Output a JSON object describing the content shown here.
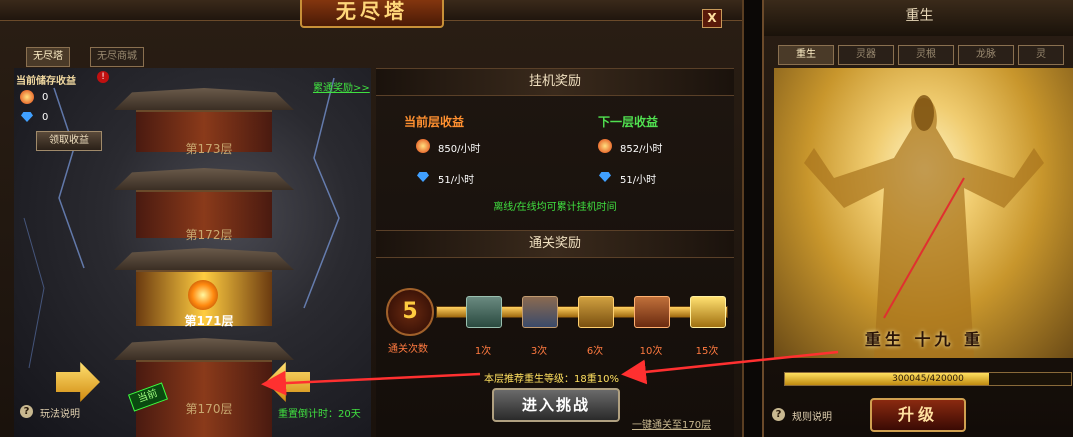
{
  "tower": {
    "title": "无尽塔",
    "close_label": "X",
    "tabs": [
      "无尽塔",
      "无尽商城"
    ],
    "stored_income_label": "当前储存收益",
    "fire_amount": "0",
    "gem_amount": "0",
    "claim_button": "领取收益",
    "cumulative_rewards_link": "累通奖励>>",
    "floors": [
      "第173层",
      "第172层",
      "第171层",
      "第170层"
    ],
    "current_badge": "当前",
    "help_link": "玩法说明",
    "reset_countdown": "重置倒计时：20天"
  },
  "idle_rewards": {
    "title": "挂机奖励",
    "current_label": "当前层收益",
    "next_label": "下一层收益",
    "current_fire": "850/小时",
    "current_gem": "51/小时",
    "next_fire": "852/小时",
    "next_gem": "51/小时",
    "note": "离线/在线均可累计挂机时间"
  },
  "clear_rewards": {
    "title": "通关奖励",
    "clear_count": "5",
    "clear_count_label": "通关次数",
    "milestones": [
      "1次",
      "3次",
      "6次",
      "10次",
      "15次"
    ],
    "recommendation": "本层推荐重生等级：18重10%",
    "challenge_button": "进入挑战",
    "quick_clear_link": "一键通关至170层"
  },
  "rebirth": {
    "title": "重生",
    "tabs": [
      "重生",
      "灵器",
      "灵根",
      "龙脉",
      "灵"
    ],
    "level_text": "重生 十九 重",
    "progress_text": "300045/420000",
    "progress_fraction": 0.714,
    "help_link": "规则说明",
    "upgrade_button": "升级"
  }
}
